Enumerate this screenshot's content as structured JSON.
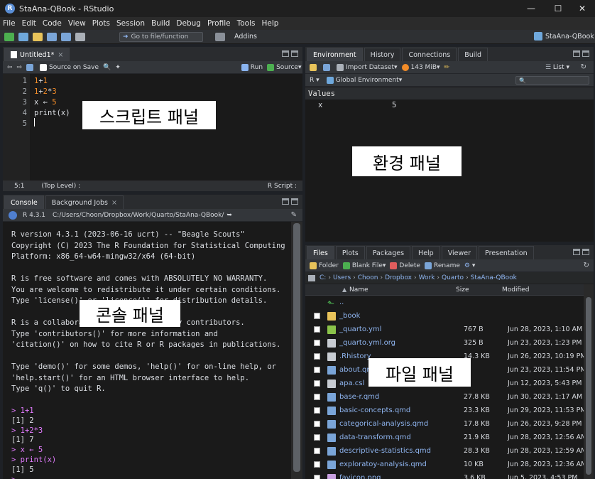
{
  "window": {
    "title": "StaAna-QBook - RStudio",
    "app_letter": "R"
  },
  "menu": [
    "File",
    "Edit",
    "Code",
    "View",
    "Plots",
    "Session",
    "Build",
    "Debug",
    "Profile",
    "Tools",
    "Help"
  ],
  "toolbar": {
    "goto_placeholder": "Go to file/function",
    "addins": "Addins",
    "project": "StaAna-QBook"
  },
  "source": {
    "tab": "Untitled1*",
    "source_on_save": "Source on Save",
    "run": "Run",
    "source": "Source",
    "lines": [
      {
        "n": "1",
        "text": "1+1"
      },
      {
        "n": "2",
        "text": "1+2*3"
      },
      {
        "n": "3",
        "text": "x ← 5"
      },
      {
        "n": "4",
        "text": "print(x)"
      },
      {
        "n": "5",
        "text": ""
      }
    ],
    "status_pos": "5:1",
    "status_level": "(Top Level) :",
    "status_type": "R Script :",
    "overlay": "스크립트 패널"
  },
  "console": {
    "tabs": [
      "Console",
      "Background Jobs"
    ],
    "path_version": "R 4.3.1",
    "path": "C:/Users/Choon/Dropbox/Work/Quarto/StaAna-QBook/",
    "lines": [
      {
        "t": "R version 4.3.1 (2023-06-16 ucrt) -- \"Beagle Scouts\"",
        "c": "out"
      },
      {
        "t": "Copyright (C) 2023 The R Foundation for Statistical Computing",
        "c": "out"
      },
      {
        "t": "Platform: x86_64-w64-mingw32/x64 (64-bit)",
        "c": "out"
      },
      {
        "t": "",
        "c": "out"
      },
      {
        "t": "R is free software and comes with ABSOLUTELY NO WARRANTY.",
        "c": "out"
      },
      {
        "t": "You are welcome to redistribute it under certain conditions.",
        "c": "out"
      },
      {
        "t": "Type 'license()' or 'licence()' for distribution details.",
        "c": "out"
      },
      {
        "t": "",
        "c": "out"
      },
      {
        "t": "R is a collaborative project with many contributors.",
        "c": "out"
      },
      {
        "t": "Type 'contributors()' for more information and",
        "c": "out"
      },
      {
        "t": "'citation()' on how to cite R or R packages in publications.",
        "c": "out"
      },
      {
        "t": "",
        "c": "out"
      },
      {
        "t": "Type 'demo()' for some demos, 'help()' for on-line help, or",
        "c": "out"
      },
      {
        "t": "'help.start()' for an HTML browser interface to help.",
        "c": "out"
      },
      {
        "t": "Type 'q()' to quit R.",
        "c": "out"
      },
      {
        "t": "",
        "c": "out"
      },
      {
        "t": "> 1+1",
        "c": "in"
      },
      {
        "t": "[1] 2",
        "c": "out"
      },
      {
        "t": "> 1+2*3",
        "c": "in"
      },
      {
        "t": "[1] 7",
        "c": "out"
      },
      {
        "t": "> x ← 5",
        "c": "in"
      },
      {
        "t": "> print(x)",
        "c": "in"
      },
      {
        "t": "[1] 5",
        "c": "out"
      },
      {
        "t": ">",
        "c": "in"
      }
    ],
    "overlay": "콘솔 패널"
  },
  "environment": {
    "tabs": [
      "Environment",
      "History",
      "Connections",
      "Build"
    ],
    "import": "Import Dataset",
    "memory": "143 MiB",
    "list": "List",
    "r_label": "R",
    "scope": "Global Environment",
    "section": "Values",
    "vars": [
      {
        "name": "x",
        "value": "5"
      }
    ],
    "overlay": "환경 패널"
  },
  "files": {
    "tabs": [
      "Files",
      "Plots",
      "Packages",
      "Help",
      "Viewer",
      "Presentation"
    ],
    "actions": {
      "folder": "Folder",
      "blank": "Blank File",
      "delete": "Delete",
      "rename": "Rename"
    },
    "crumbs": [
      "C:",
      "Users",
      "Choon",
      "Dropbox",
      "Work",
      "Quarto",
      "StaAna-QBook"
    ],
    "headers": {
      "name": "Name",
      "size": "Size",
      "modified": "Modified"
    },
    "rows": [
      {
        "name": "..",
        "size": "",
        "mod": "",
        "icon": "up",
        "cb": false
      },
      {
        "name": "_book",
        "size": "",
        "mod": "",
        "icon": "folder",
        "cb": true
      },
      {
        "name": "_quarto.yml",
        "size": "767 B",
        "mod": "Jun 28, 2023, 1:10 AM",
        "icon": "yml",
        "cb": true
      },
      {
        "name": "_quarto.yml.org",
        "size": "325 B",
        "mod": "Jun 23, 2023, 1:23 PM",
        "icon": "doc",
        "cb": true
      },
      {
        "name": ".Rhistory",
        "size": "14.3 KB",
        "mod": "Jun 26, 2023, 10:19 PM",
        "icon": "doc",
        "cb": true
      },
      {
        "name": "about.qmd",
        "size": "",
        "mod": "Jun 23, 2023, 11:54 PM",
        "icon": "qmd",
        "cb": true
      },
      {
        "name": "apa.csl",
        "size": "",
        "mod": "Jun 12, 2023, 5:43 PM",
        "icon": "doc",
        "cb": true
      },
      {
        "name": "base-r.qmd",
        "size": "27.8 KB",
        "mod": "Jun 30, 2023, 1:17 AM",
        "icon": "qmd",
        "cb": true
      },
      {
        "name": "basic-concepts.qmd",
        "size": "23.3 KB",
        "mod": "Jun 29, 2023, 11:53 PM",
        "icon": "qmd",
        "cb": true
      },
      {
        "name": "categorical-analysis.qmd",
        "size": "17.8 KB",
        "mod": "Jun 26, 2023, 9:28 PM",
        "icon": "qmd",
        "cb": true
      },
      {
        "name": "data-transform.qmd",
        "size": "21.9 KB",
        "mod": "Jun 28, 2023, 12:56 AM",
        "icon": "qmd",
        "cb": true
      },
      {
        "name": "descriptive-statistics.qmd",
        "size": "28.3 KB",
        "mod": "Jun 28, 2023, 12:59 AM",
        "icon": "qmd",
        "cb": true
      },
      {
        "name": "exploratoy-analysis.qmd",
        "size": "10 KB",
        "mod": "Jun 28, 2023, 12:36 AM",
        "icon": "qmd",
        "cb": true
      },
      {
        "name": "favicon.png",
        "size": "3.6 KB",
        "mod": "Jun 5, 2023, 4:53 PM",
        "icon": "png",
        "cb": true
      }
    ],
    "overlay": "파일 패널"
  },
  "colors": {
    "link": "#8fb5f0",
    "prompt": "#e37cff",
    "number": "#f28c28",
    "text": "#dcdfe4"
  }
}
